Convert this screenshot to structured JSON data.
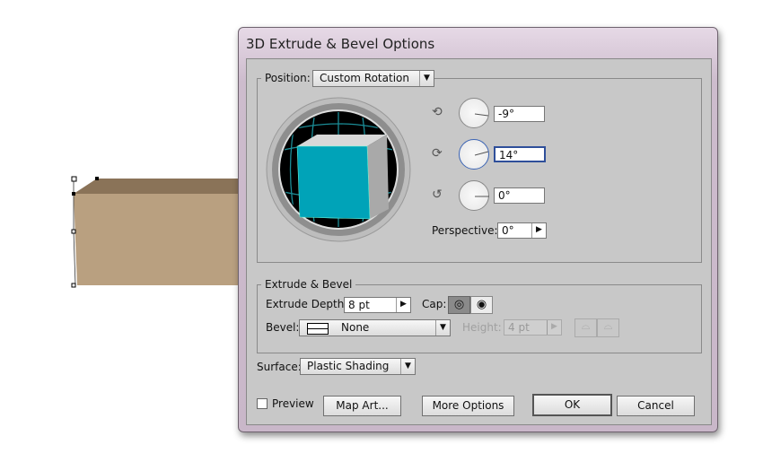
{
  "dialog": {
    "title": "3D Extrude & Bevel Options"
  },
  "position": {
    "label": "Position:",
    "value": "Custom Rotation",
    "x_rotation": "-9°",
    "y_rotation": "14°",
    "z_rotation": "0°",
    "perspective_label": "Perspective:",
    "perspective": "0°"
  },
  "extrude": {
    "legend": "Extrude & Bevel",
    "depth_label": "Extrude Depth:",
    "depth": "8 pt",
    "cap_label": "Cap:",
    "bevel_label": "Bevel:",
    "bevel": "None",
    "height_label": "Height:",
    "height": "4 pt"
  },
  "surface": {
    "label": "Surface:",
    "value": "Plastic Shading"
  },
  "footer": {
    "preview": "Preview",
    "preview_checked": false,
    "map_art": "Map Art...",
    "more_options": "More Options",
    "ok": "OK",
    "cancel": "Cancel"
  },
  "colors": {
    "cube_front": "#00a3b8",
    "object_fill": "#b9a080",
    "object_top": "#8a7358"
  }
}
